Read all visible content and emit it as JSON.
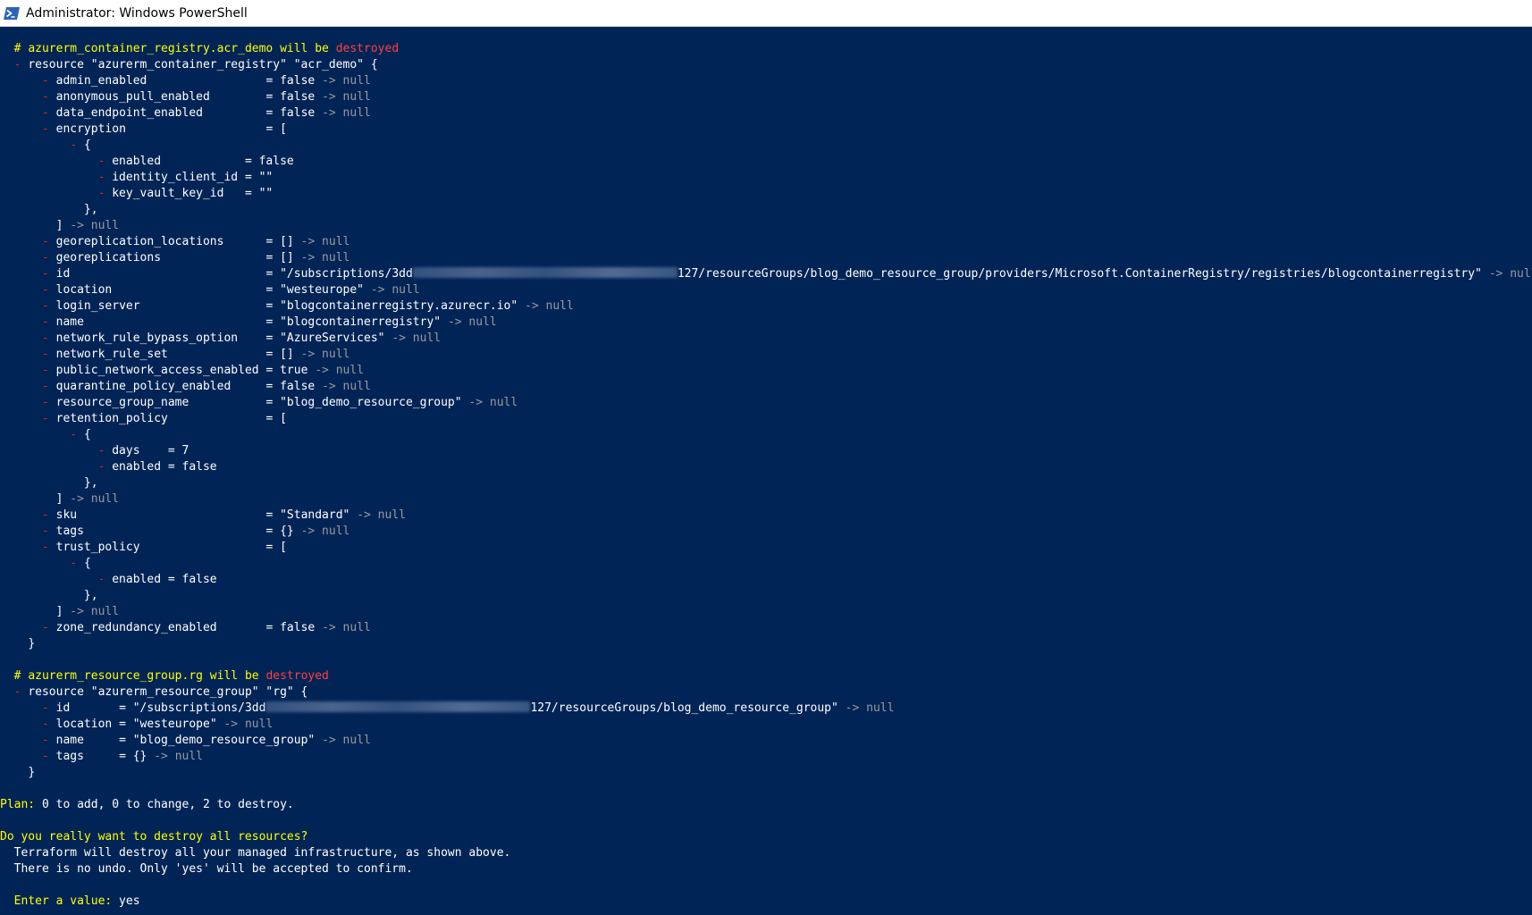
{
  "window": {
    "title": "Administrator: Windows PowerShell",
    "icon": "powershell-icon"
  },
  "colors": {
    "background": "#012456",
    "text": "#ffffff",
    "comment": "#ffff00",
    "destroyed": "#ff4040",
    "arrow_null": "#9a9a9a"
  },
  "block1": {
    "comment_prefix": "# ",
    "resource_ref": "azurerm_container_registry.acr_demo",
    "will_be": " will be ",
    "destroyed": "destroyed",
    "resource_line": "resource \"azurerm_container_registry\" \"acr_demo\" {",
    "admin_enabled": {
      "key": "admin_enabled",
      "value": "false"
    },
    "anonymous_pull_enabled": {
      "key": "anonymous_pull_enabled",
      "value": "false"
    },
    "data_endpoint_enabled": {
      "key": "data_endpoint_enabled",
      "value": "false"
    },
    "encryption": {
      "key": "encryption",
      "open": "[",
      "brace_open": "{",
      "enabled": "enabled            = false",
      "identity_client_id": "identity_client_id = \"\"",
      "key_vault_key_id": "key_vault_key_id   = \"\"",
      "brace_close": "},",
      "close": "]"
    },
    "georeplication_locations": {
      "key": "georeplication_locations",
      "value": "[]"
    },
    "georeplications": {
      "key": "georeplications",
      "value": "[]"
    },
    "id": {
      "key": "id",
      "value_start": "\"/subscriptions/3dd",
      "value_end": "127/resourceGroups/blog_demo_resource_group/providers/Microsoft.ContainerRegistry/registries/blogcontainerregistry\""
    },
    "location": {
      "key": "location",
      "value": "\"westeurope\""
    },
    "login_server": {
      "key": "login_server",
      "value": "\"blogcontainerregistry.azurecr.io\""
    },
    "name": {
      "key": "name",
      "value": "\"blogcontainerregistry\""
    },
    "network_rule_bypass_option": {
      "key": "network_rule_bypass_option",
      "value": "\"AzureServices\""
    },
    "network_rule_set": {
      "key": "network_rule_set",
      "value": "[]"
    },
    "public_network_access_enabled": {
      "key": "public_network_access_enabled",
      "value": "true"
    },
    "quarantine_policy_enabled": {
      "key": "quarantine_policy_enabled",
      "value": "false"
    },
    "resource_group_name": {
      "key": "resource_group_name",
      "value": "\"blog_demo_resource_group\""
    },
    "retention_policy": {
      "key": "retention_policy",
      "open": "[",
      "brace_open": "{",
      "days": "days    = 7",
      "enabled": "enabled = false",
      "brace_close": "},",
      "close": "]"
    },
    "sku": {
      "key": "sku",
      "value": "\"Standard\""
    },
    "tags": {
      "key": "tags",
      "value": "{}"
    },
    "trust_policy": {
      "key": "trust_policy",
      "open": "[",
      "brace_open": "{",
      "enabled": "enabled = false",
      "brace_close": "},",
      "close": "]"
    },
    "zone_redundancy_enabled": {
      "key": "zone_redundancy_enabled",
      "value": "false"
    },
    "close": "}"
  },
  "block2": {
    "comment_prefix": "# ",
    "resource_ref": "azurerm_resource_group.rg",
    "will_be": " will be ",
    "destroyed": "destroyed",
    "resource_line": "resource \"azurerm_resource_group\" \"rg\" {",
    "id": {
      "key": "id",
      "value_start": "\"/subscriptions/3dd",
      "value_end": "127/resourceGroups/blog_demo_resource_group\""
    },
    "location": {
      "key": "location",
      "value": "\"westeurope\""
    },
    "name": {
      "key": "name",
      "value": "\"blog_demo_resource_group\""
    },
    "tags": {
      "key": "tags",
      "value": "{}"
    },
    "close": "}"
  },
  "syntax": {
    "minus": "-",
    "equals": "=",
    "arrow_null": "-> null"
  },
  "plan": {
    "label": "Plan:",
    "text": " 0 to add, 0 to change, 2 to destroy."
  },
  "prompt": {
    "question": "Do you really want to destroy all resources?",
    "line1": "  Terraform will destroy all your managed infrastructure, as shown above.",
    "line2": "  There is no undo. Only 'yes' will be accepted to confirm.",
    "enter_label": "  Enter a value:",
    "enter_value": " yes"
  }
}
